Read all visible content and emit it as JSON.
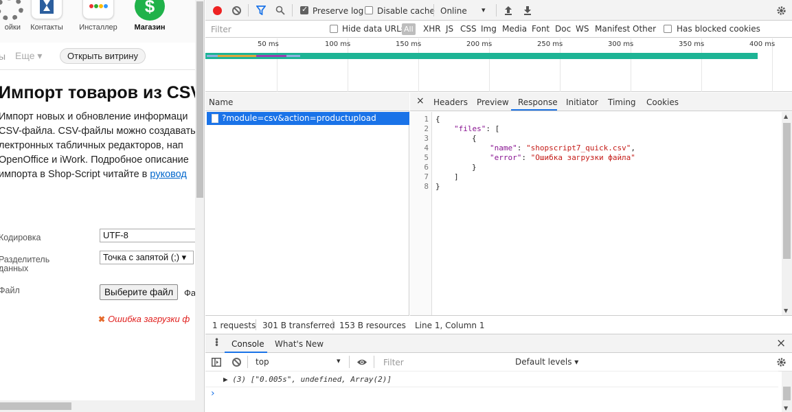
{
  "page": {
    "apps": [
      {
        "label": "ойки",
        "icon": "gear-icon"
      },
      {
        "label": "Контакты",
        "icon": "contacts-icon"
      },
      {
        "label": "Инсталлер",
        "icon": "installer-icon"
      },
      {
        "label": "Магазин",
        "icon": "shop-icon",
        "glyph": "$"
      }
    ],
    "subnav": {
      "tail": "ы",
      "more": "Еще ▾",
      "storefront_button": "Открыть витрину"
    },
    "title": "Импорт товаров из CSV",
    "description_lines": [
      "Импорт новых и обновление информаци",
      "CSV-файла. CSV-файлы можно создавать",
      "лектронных табличных редакторов, нап",
      "OpenOffice и iWork. Подробное описание",
      "импорта в Shop-Script читайте в "
    ],
    "description_link": "руковод",
    "form": {
      "encoding_label": "Кодировка",
      "encoding_value": "UTF-8",
      "separator_label_1": "Разделитель",
      "separator_label_2": "данных",
      "separator_value": "Точка с запятой (;) ▾",
      "file_label": "Файл",
      "file_button": "Выберите файл",
      "file_status": "Фа",
      "error": "Ошибка загрузки ф"
    }
  },
  "devtools": {
    "toolbar": {
      "preserve_log": "Preserve log",
      "preserve_log_checked": true,
      "disable_cache": "Disable cache",
      "disable_cache_checked": false,
      "throttling": "Online",
      "throttling_arrow": "▾"
    },
    "filter_bar": {
      "placeholder": "Filter",
      "hide_data_urls": "Hide data URLs",
      "all": "All",
      "types": [
        "XHR",
        "JS",
        "CSS",
        "Img",
        "Media",
        "Font",
        "Doc",
        "WS",
        "Manifest",
        "Other"
      ],
      "blocked_cookies": "Has blocked cookies"
    },
    "timeline_ticks": [
      "50 ms",
      "100 ms",
      "150 ms",
      "200 ms",
      "250 ms",
      "300 ms",
      "350 ms",
      "400 ms"
    ],
    "requests": {
      "header": "Name",
      "items": [
        "?module=csv&action=productupload"
      ],
      "status": [
        "1 requests",
        "301 B transferred",
        "153 B resources"
      ]
    },
    "detail_tabs": {
      "close": "×",
      "items": [
        "Headers",
        "Preview",
        "Response",
        "Initiator",
        "Timing",
        "Cookies"
      ],
      "active": "Response"
    },
    "response_lines": [
      "1",
      "2",
      "3",
      "4",
      "5",
      "6",
      "7",
      "8"
    ],
    "response": {
      "open_brace": "{",
      "key_files": "\"files\"",
      "files_tail": ": [",
      "inner_open": "{",
      "key_name": "\"name\"",
      "val_name": "\"shopscript7_quick.csv\"",
      "key_error": "\"error\"",
      "val_error": "\"Ошибка загрузки файла\"",
      "inner_close": "}",
      "array_close": "]",
      "close_brace": "}"
    },
    "cursor_position": "Line 1, Column 1",
    "console": {
      "tabs": [
        "Console",
        "What's New"
      ],
      "close": "×",
      "context": "top",
      "context_arrow": "▾",
      "filter_placeholder": "Filter",
      "levels": "Default levels ▾",
      "log_line": "▶ (3) [\"0.005s\", undefined, Array(2)]",
      "prompt": "›"
    }
  }
}
